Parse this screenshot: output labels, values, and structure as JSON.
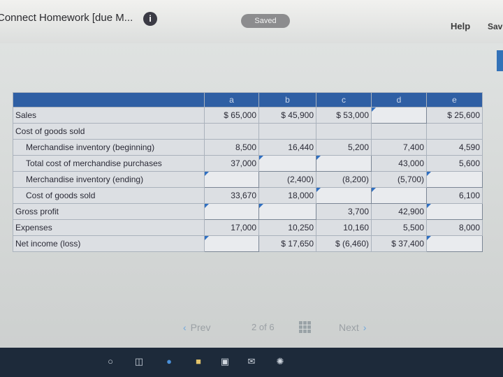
{
  "header": {
    "app_title": "Connect Homework [due M...",
    "info_icon": "info-icon",
    "saved_label": "Saved",
    "help_label": "Help",
    "save_label": "Sav"
  },
  "table": {
    "columns": [
      "",
      "a",
      "b",
      "c",
      "d",
      "e"
    ],
    "rows": [
      {
        "label": "Sales",
        "indent": 0,
        "cells": [
          "$ 65,000",
          "$ 45,900",
          "$ 53,000",
          "",
          "$ 25,600"
        ]
      },
      {
        "label": "Cost of goods sold",
        "indent": 0,
        "cells": []
      },
      {
        "label": "Merchandise inventory (beginning)",
        "indent": 1,
        "cells": [
          "8,500",
          "16,440",
          "5,200",
          "7,400",
          "4,590"
        ]
      },
      {
        "label": "Total cost of merchandise purchases",
        "indent": 1,
        "cells": [
          "37,000",
          "",
          "",
          "43,000",
          "5,600"
        ]
      },
      {
        "label": "Merchandise inventory (ending)",
        "indent": 1,
        "cells": [
          "",
          "(2,400)",
          "(8,200)",
          "(5,700)",
          ""
        ]
      },
      {
        "label": "Cost of goods sold",
        "indent": 1,
        "cells": [
          "33,670",
          "18,000",
          "",
          "",
          "6,100"
        ]
      },
      {
        "label": "Gross profit",
        "indent": 0,
        "cells": [
          "",
          "",
          "3,700",
          "42,900",
          ""
        ]
      },
      {
        "label": "Expenses",
        "indent": 0,
        "cells": [
          "17,000",
          "10,250",
          "10,160",
          "5,500",
          "8,000"
        ]
      },
      {
        "label": "Net income (loss)",
        "indent": 0,
        "cells": [
          "",
          "$ 17,650",
          "$ (6,460)",
          "$ 37,400",
          ""
        ]
      }
    ]
  },
  "pagination": {
    "prev_label": "Prev",
    "page_current": "2",
    "page_of": "of",
    "page_total": "6",
    "next_label": "Next"
  },
  "taskbar": {
    "icons": [
      "cortana-icon",
      "task-view-icon",
      "edge-icon",
      "file-explorer-icon",
      "store-icon",
      "mail-icon",
      "photos-icon"
    ]
  }
}
